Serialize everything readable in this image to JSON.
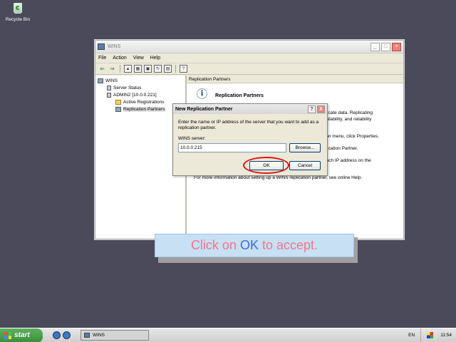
{
  "desktop": {
    "icon_label": "Recycle Bin"
  },
  "window": {
    "title": "WINS",
    "menu": [
      "File",
      "Action",
      "View",
      "Help"
    ],
    "tree": [
      {
        "label": "WINS"
      },
      {
        "label": "Server Status"
      },
      {
        "label": "ADMIN2 [10.0.0.221]"
      },
      {
        "label": "Active Registrations"
      },
      {
        "label": "Replication Partners"
      }
    ],
    "content_header": "Replication Partners",
    "info_title": "Replication Partners",
    "desc_lines": [
      "plicate data. Replicating",
      "vailability, and reliability",
      "tion menu, click Properties.",
      "plication Partner.",
      "each IP address on the",
      "For more information about setting up a WINS replication partner, see online Help."
    ]
  },
  "dialog": {
    "title": "New Replication Partner",
    "help_label": "?",
    "close_label": "X",
    "instruction": "Enter the name or IP address of the server that you want to add as a replication partner.",
    "server_label": "WINS server:",
    "server_value": "10.0.0.215",
    "browse_label": "Browse...",
    "ok_label": "OK",
    "cancel_label": "Cancel"
  },
  "caption": {
    "prefix": "Click on ",
    "keyword": "OK",
    "suffix": " to accept."
  },
  "taskbar": {
    "start_label": "start",
    "task_label": "WINS",
    "lang": "EN",
    "clock": "11:54"
  }
}
